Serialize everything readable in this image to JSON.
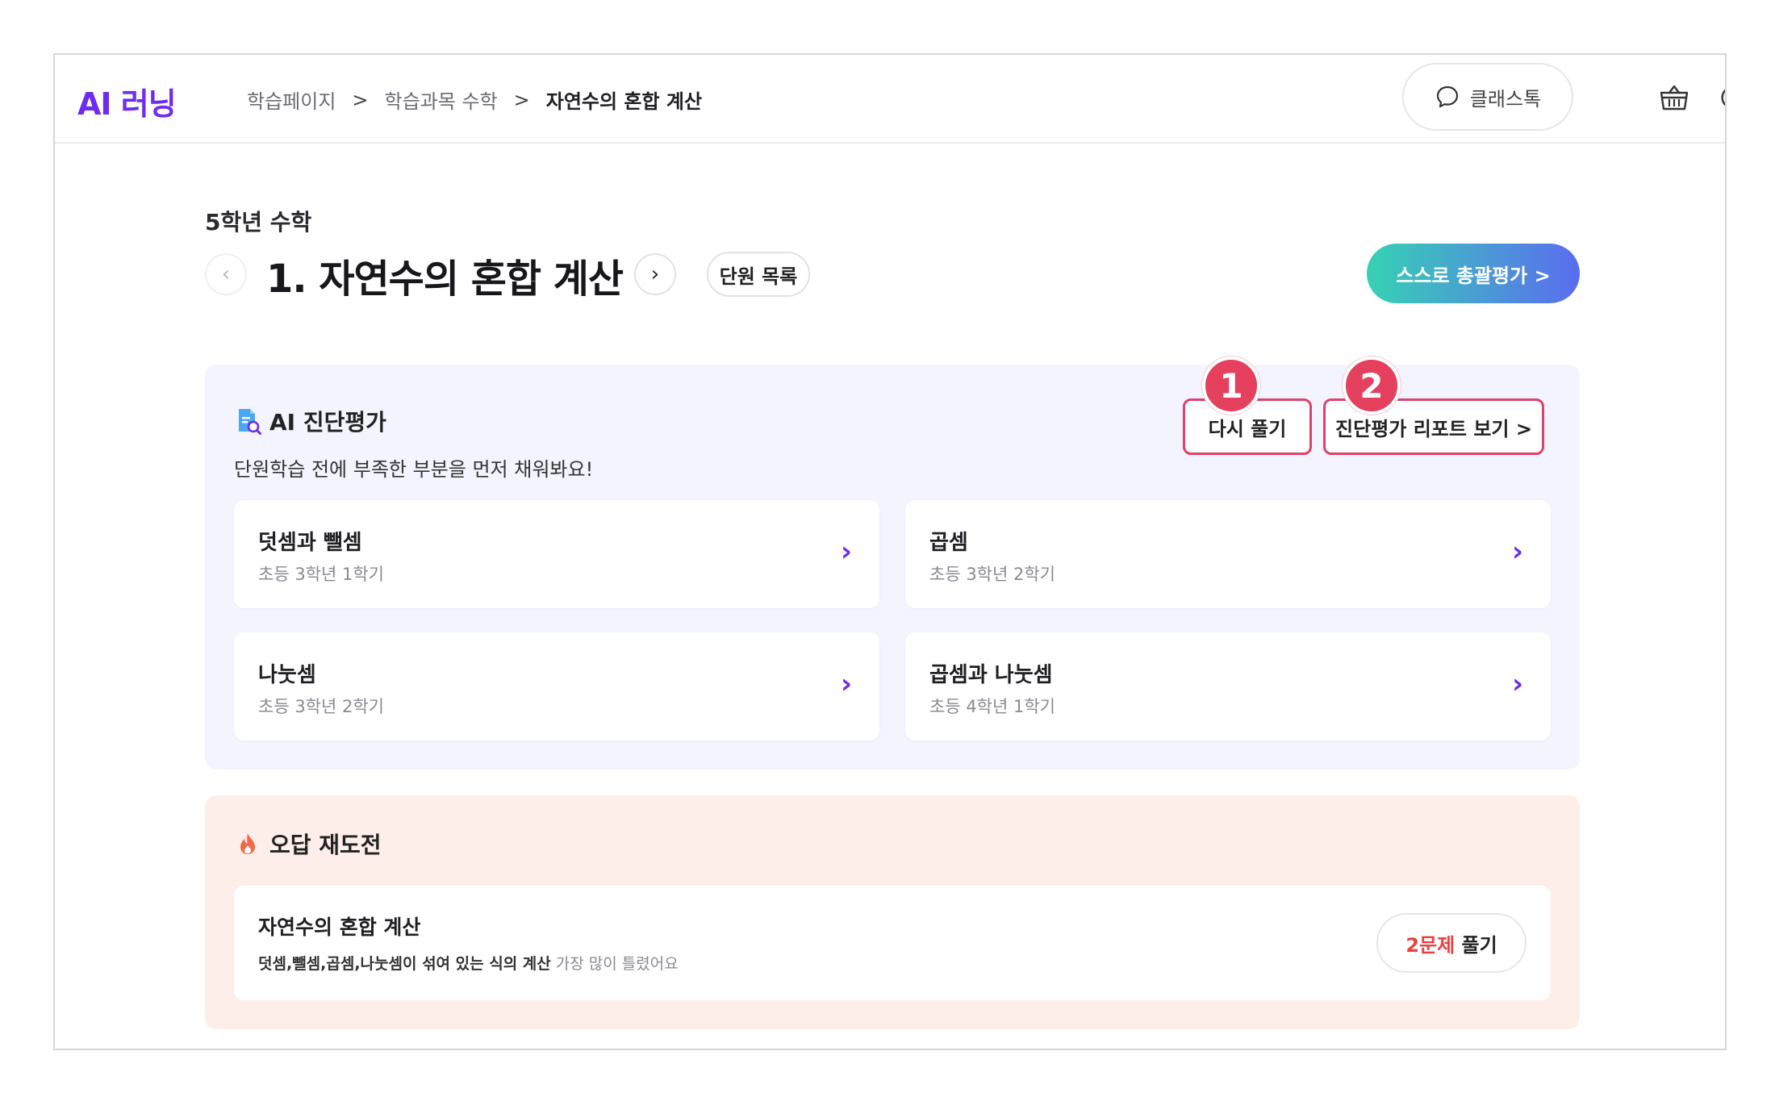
{
  "header": {
    "logo": "AI 러닝",
    "breadcrumb": [
      "학습페이지",
      "학습과목 수학",
      "자연수의 혼합 계산"
    ],
    "class_talk_label": "클래스톡",
    "icons": [
      "chat-bubble-icon",
      "basket-icon",
      "logout-icon"
    ]
  },
  "unit": {
    "grade_label": "5학년 수학",
    "title": "1. 자연수의 혼합 계산",
    "list_button": "단원 목록",
    "self_eval_button": "스스로 총괄평가 >"
  },
  "ai_diagnosis": {
    "title": "AI 진단평가",
    "subtitle": "단원학습 전에 부족한 부분을 먼저 채워봐요!",
    "retry_button": "다시 풀기",
    "report_button": "진단평가 리포트 보기 >",
    "badges": [
      "1",
      "2"
    ],
    "cards": [
      {
        "title": "덧셈과 뺄셈",
        "sub": "초등 3학년 1학기"
      },
      {
        "title": "곱셈",
        "sub": "초등 3학년 2학기"
      },
      {
        "title": "나눗셈",
        "sub": "초등 3학년 2학기"
      },
      {
        "title": "곱셈과 나눗셈",
        "sub": "초등 4학년 1학기"
      }
    ],
    "accent_color": "#6e2bf2"
  },
  "wrong_answer": {
    "title": "오답 재도전",
    "card_title": "자연수의 혼합 계산",
    "card_desc_bold": "덧셈,뺄셈,곱셈,나눗셈이 섞여 있는 식의 계산",
    "card_desc_rest": " 가장 많이 틀렸어요",
    "solve_count": "2문제",
    "solve_label": " 풀기"
  }
}
